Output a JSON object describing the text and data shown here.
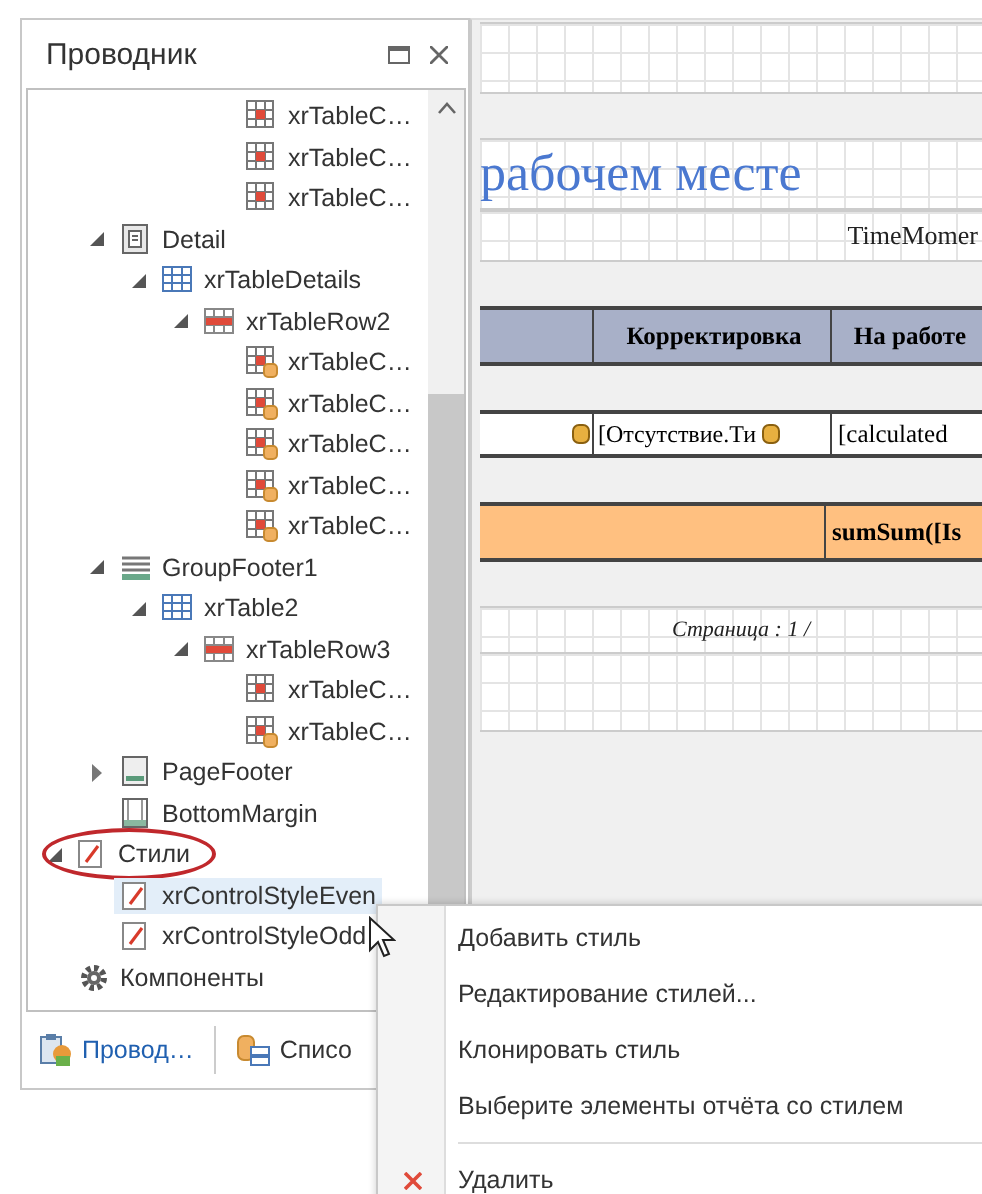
{
  "panel": {
    "title": "Проводник",
    "tree": {
      "scrolled_off_cells": [
        {
          "label": "xrTableC…",
          "kind": "cell"
        },
        {
          "label": "xrTableC…",
          "kind": "cell"
        },
        {
          "label": "xrTableC…",
          "kind": "cell"
        }
      ],
      "bands": [
        {
          "label": "Detail",
          "kind": "detail",
          "expanded": true,
          "selected": false,
          "children": [
            {
              "label": "xrTableDetails",
              "kind": "table",
              "expanded": true,
              "selected": false,
              "children": [
                {
                  "label": "xrTableRow2",
                  "kind": "row",
                  "expanded": true,
                  "selected": false,
                  "children": [
                    {
                      "label": "xrTableC…",
                      "kind": "bound-cell",
                      "selected": false
                    },
                    {
                      "label": "xrTableC…",
                      "kind": "bound-cell",
                      "selected": false
                    },
                    {
                      "label": "xrTableC…",
                      "kind": "bound-cell",
                      "selected": false
                    },
                    {
                      "label": "xrTableC…",
                      "kind": "bound-cell",
                      "selected": false
                    },
                    {
                      "label": "xrTableC…",
                      "kind": "bound-cell",
                      "selected": false
                    }
                  ]
                }
              ]
            }
          ]
        },
        {
          "label": "GroupFooter1",
          "kind": "footer",
          "expanded": true,
          "selected": false,
          "children": [
            {
              "label": "xrTable2",
              "kind": "table",
              "expanded": true,
              "selected": false,
              "children": [
                {
                  "label": "xrTableRow3",
                  "kind": "row",
                  "expanded": true,
                  "selected": false,
                  "children": [
                    {
                      "label": "xrTableC…",
                      "kind": "cell",
                      "selected": false
                    },
                    {
                      "label": "xrTableC…",
                      "kind": "bound-cell",
                      "selected": false
                    }
                  ]
                }
              ]
            }
          ]
        },
        {
          "label": "PageFooter",
          "kind": "pagefooter",
          "expanded": false,
          "selected": false
        },
        {
          "label": "BottomMargin",
          "kind": "margin",
          "selected": false
        }
      ],
      "roots": [
        {
          "label": "Стили",
          "kind": "styles",
          "expanded": true,
          "selected": false,
          "circled": true,
          "children": [
            {
              "label": "xrControlStyleEven",
              "kind": "style",
              "selected": true
            },
            {
              "label": "xrControlStyleOdd",
              "kind": "style",
              "selected": false
            }
          ]
        },
        {
          "label": "Компоненты",
          "kind": "components",
          "selected": false,
          "circled": false
        }
      ]
    },
    "tabs": [
      {
        "label": "Провод…",
        "kind": "explorer",
        "selected": true
      },
      {
        "label": "Списо",
        "kind": "fields",
        "selected": false
      }
    ]
  },
  "report": {
    "title": "рабочем месте",
    "time_field": "TimeMomer",
    "header_cells": [
      "",
      "Корректировка",
      "На работе"
    ],
    "data_cells": [
      "",
      "[Отсутствие.Ти",
      "[calculated"
    ],
    "total_cells": [
      "",
      "sumSum([Is"
    ],
    "page_info": "Страница : 1 /"
  },
  "context_menu": [
    {
      "label": "Добавить стиль",
      "kind": "plain"
    },
    {
      "label": "Редактирование стилей...",
      "kind": "plain"
    },
    {
      "label": "Клонировать стиль",
      "kind": "plain"
    },
    {
      "label": "Выберите элементы отчёта со стилем",
      "kind": "plain"
    },
    {
      "label": "Удалить",
      "kind": "delete"
    }
  ]
}
